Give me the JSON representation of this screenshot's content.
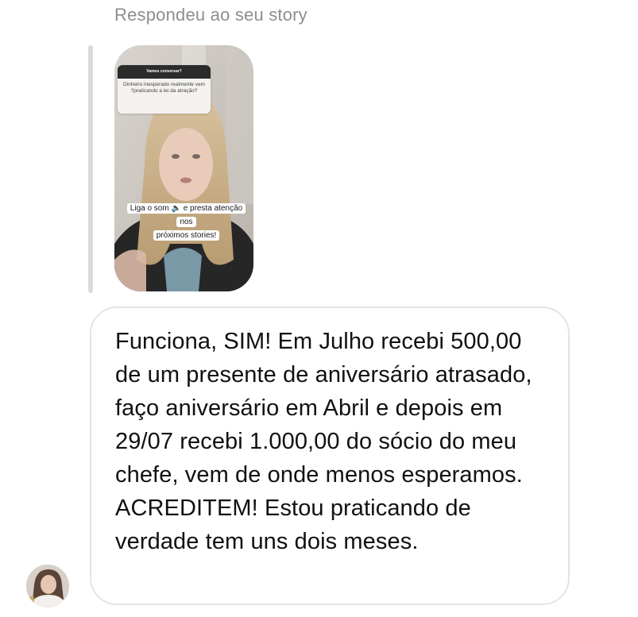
{
  "reply_context": {
    "label": "Respondeu ao seu story"
  },
  "story_preview": {
    "question_sticker": {
      "title": "Vamos conversar?",
      "question": "Dinheiro inesperado realmente vem ?praticando a lei da atração?"
    },
    "sound_sticker": {
      "line1": "Liga o som 🔈 e presta atenção nos",
      "line2": "próximos stories!"
    }
  },
  "message": {
    "text": "Funciona, SIM! Em Julho recebi 500,00 de um presente de aniversário atrasado, faço aniversário em Abril e depois em 29/07 recebi 1.000,00 do sócio do meu chefe, vem de onde menos esperamos. ACREDITEM! Estou praticando de verdade tem uns dois meses."
  },
  "colors": {
    "muted_text": "#8e8e8e",
    "bubble_border": "#e4e4e4",
    "quote_bar": "#dbdbdb"
  },
  "icons": {
    "avatar": "user-avatar",
    "sound": "speaker-icon"
  }
}
